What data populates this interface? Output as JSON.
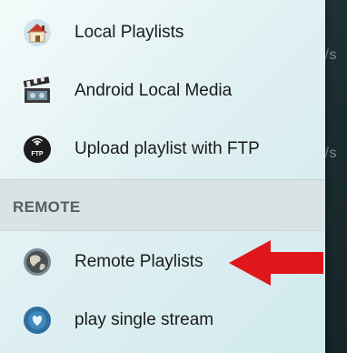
{
  "background": {
    "hint_lines": [
      "k/s",
      "k/s"
    ]
  },
  "drawer": {
    "local_items": [
      {
        "label": "Local Playlists",
        "icon": "house-icon"
      },
      {
        "label": "Android Local Media",
        "icon": "film-clapper-icon"
      },
      {
        "label": "Upload playlist with FTP",
        "icon": "ftp-icon",
        "icon_text": "FTP"
      }
    ],
    "remote_section": {
      "title": "REMOTE",
      "items": [
        {
          "label": "Remote Playlists",
          "icon": "globe-icon",
          "highlighted_by_arrow": true
        },
        {
          "label": "play single stream",
          "icon": "stream-icon"
        }
      ]
    }
  },
  "colors": {
    "arrow": "#e0161d",
    "section_bg": "#d9e3e5",
    "section_title": "#555e61",
    "app_background": "#1b2a2d"
  }
}
